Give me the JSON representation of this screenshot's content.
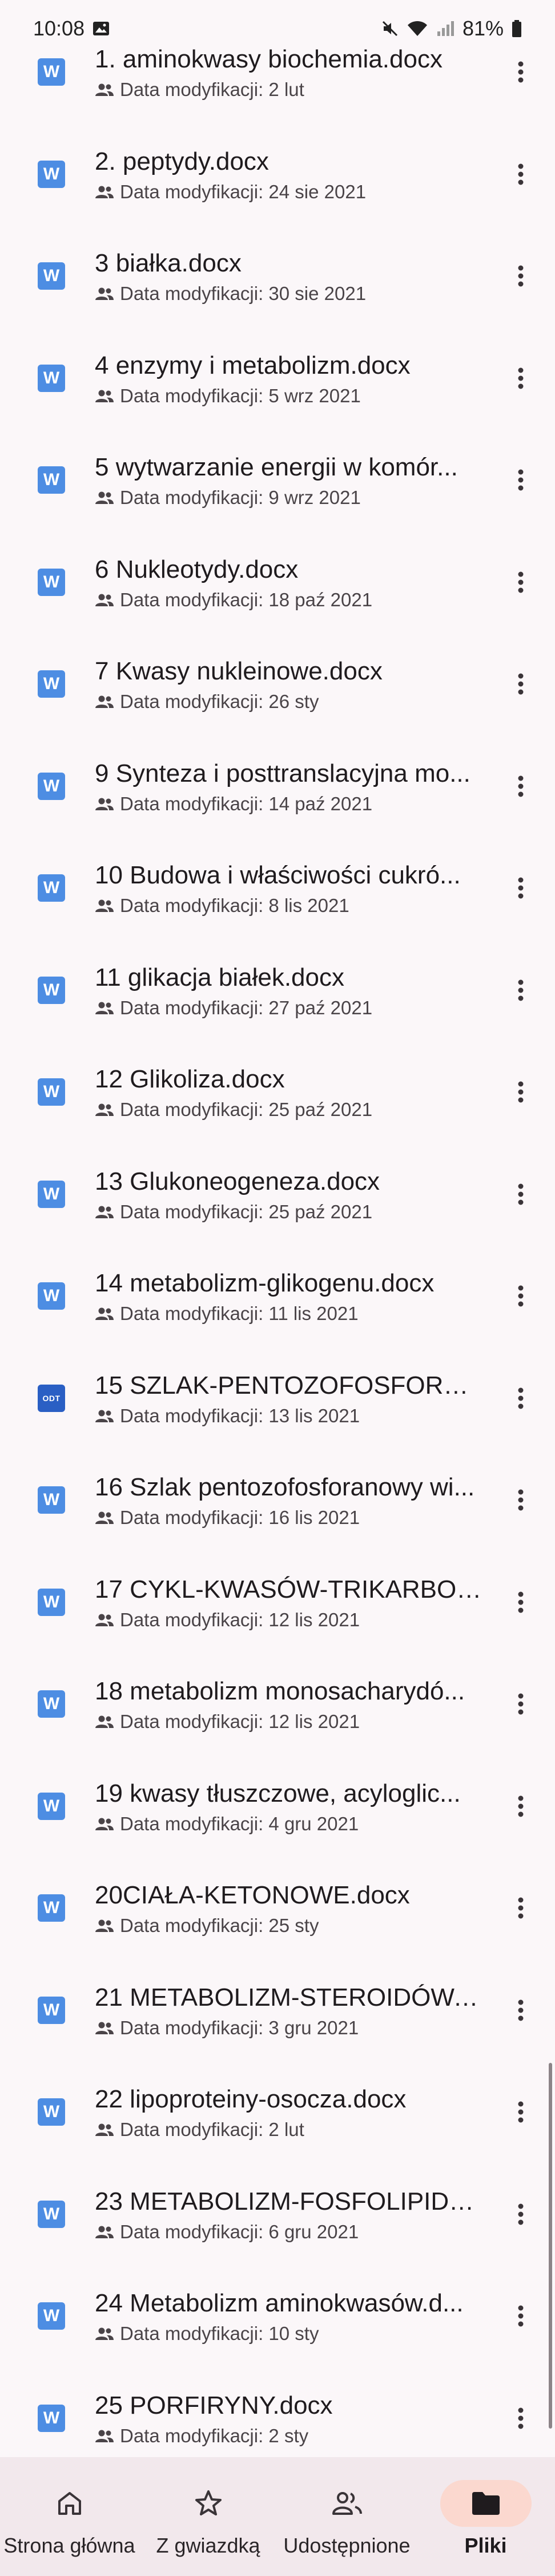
{
  "status_bar": {
    "time": "10:08",
    "battery": "81%",
    "icons": [
      "gallery-icon",
      "mute-icon",
      "wifi-icon",
      "signal-icon",
      "battery-icon"
    ]
  },
  "files": [
    {
      "title": "1. aminokwasy biochemia.docx",
      "meta": "Data modyfikacji: 2 lut",
      "type": "W"
    },
    {
      "title": "2. peptydy.docx",
      "meta": "Data modyfikacji: 24 sie 2021",
      "type": "W"
    },
    {
      "title": "3 białka.docx",
      "meta": "Data modyfikacji: 30 sie 2021",
      "type": "W"
    },
    {
      "title": "4 enzymy i metabolizm.docx",
      "meta": "Data modyfikacji: 5 wrz 2021",
      "type": "W"
    },
    {
      "title": "5 wytwarzanie energii w komór...",
      "meta": "Data modyfikacji: 9 wrz 2021",
      "type": "W"
    },
    {
      "title": "6 Nukleotydy.docx",
      "meta": "Data modyfikacji: 18 paź 2021",
      "type": "W"
    },
    {
      "title": "7 Kwasy nukleinowe.docx",
      "meta": "Data modyfikacji: 26 sty",
      "type": "W"
    },
    {
      "title": "9 Synteza i posttranslacyjna mo...",
      "meta": "Data modyfikacji: 14 paź 2021",
      "type": "W"
    },
    {
      "title": "10 Budowa i właściwości cukró...",
      "meta": "Data modyfikacji: 8 lis 2021",
      "type": "W"
    },
    {
      "title": "11 glikacja białek.docx",
      "meta": "Data modyfikacji: 27 paź 2021",
      "type": "W"
    },
    {
      "title": "12 Glikoliza.docx",
      "meta": "Data modyfikacji: 25 paź 2021",
      "type": "W"
    },
    {
      "title": "13 Glukoneogeneza.docx",
      "meta": "Data modyfikacji: 25 paź 2021",
      "type": "W"
    },
    {
      "title": "14 metabolizm-glikogenu.docx",
      "meta": "Data modyfikacji: 11 lis 2021",
      "type": "W"
    },
    {
      "title": "15 SZLAK-PENTOZOFOSFORAN...",
      "meta": "Data modyfikacji: 13 lis 2021",
      "type": "ODT"
    },
    {
      "title": "16 Szlak pentozofosforanowy wi...",
      "meta": "Data modyfikacji: 16 lis 2021",
      "type": "W"
    },
    {
      "title": "17 CYKL-KWASÓW-TRIKARBOK...",
      "meta": "Data modyfikacji: 12 lis 2021",
      "type": "W"
    },
    {
      "title": "18 metabolizm monosacharydó...",
      "meta": "Data modyfikacji: 12 lis 2021",
      "type": "W"
    },
    {
      "title": "19 kwasy tłuszczowe, acyloglic...",
      "meta": "Data modyfikacji: 4 gru 2021",
      "type": "W"
    },
    {
      "title": "20CIAŁA-KETONOWE.docx",
      "meta": "Data modyfikacji: 25 sty",
      "type": "W"
    },
    {
      "title": "21 METABOLIZM-STEROIDÓW.d...",
      "meta": "Data modyfikacji: 3 gru 2021",
      "type": "W"
    },
    {
      "title": "22 lipoproteiny-osocza.docx",
      "meta": "Data modyfikacji: 2 lut",
      "type": "W"
    },
    {
      "title": "23 METABOLIZM-FOSFOLIPIDÓ...",
      "meta": "Data modyfikacji: 6 gru 2021",
      "type": "W"
    },
    {
      "title": "24 Metabolizm aminokwasów.d...",
      "meta": "Data modyfikacji: 10 sty",
      "type": "W"
    },
    {
      "title": "25 PORFIRYNY.docx",
      "meta": "Data modyfikacji: 2 sty",
      "type": "W"
    }
  ],
  "bottom_nav": [
    {
      "label": "Strona główna",
      "icon": "home-icon",
      "active": false
    },
    {
      "label": "Z gwiazdką",
      "icon": "star-icon",
      "active": false
    },
    {
      "label": "Udostępnione",
      "icon": "people-icon",
      "active": false
    },
    {
      "label": "Pliki",
      "icon": "folder-icon",
      "active": true
    }
  ],
  "colors": {
    "background": "#fbf7f9",
    "word_icon": "#4d8de3",
    "odt_icon": "#2a5fc4",
    "nav_background": "#f2e8ec",
    "nav_active_pill": "#fbd8cf"
  }
}
